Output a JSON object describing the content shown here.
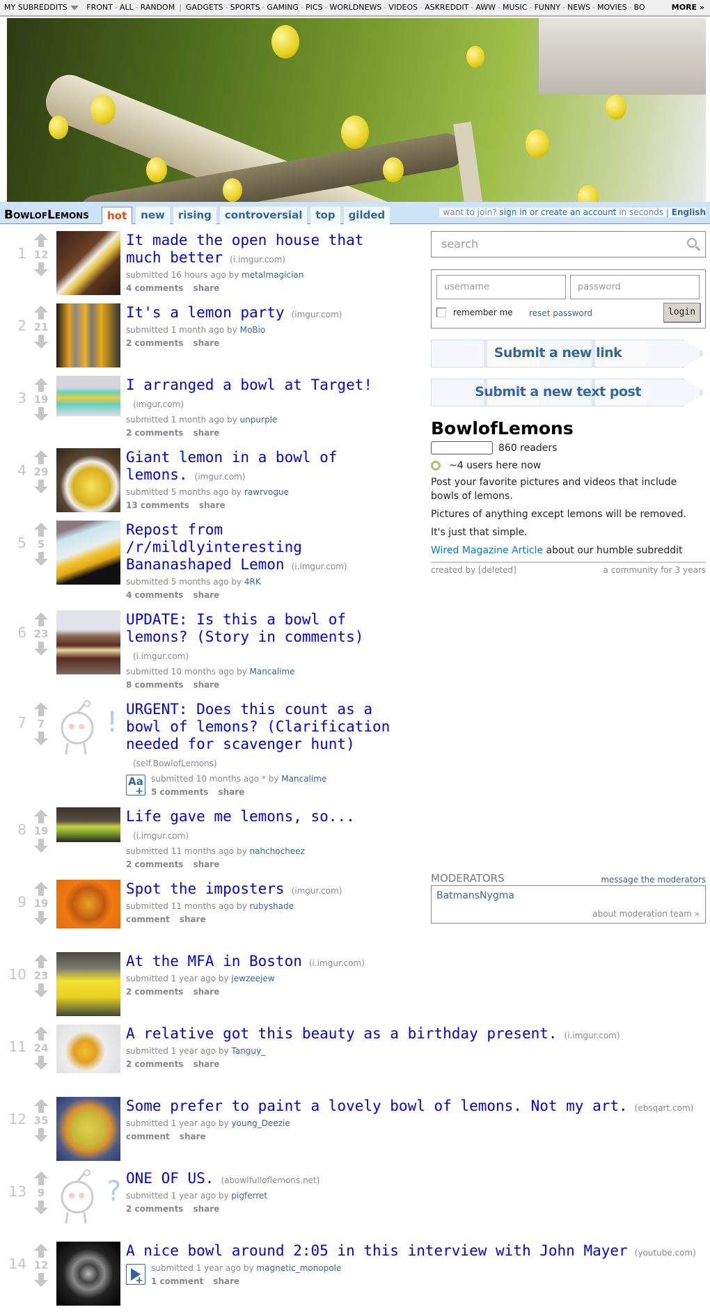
{
  "topbar": {
    "my_subreddits": "My Subreddits",
    "primary": [
      "Front",
      "All",
      "Random"
    ],
    "subs": [
      "Gadgets",
      "Sports",
      "Gaming",
      "Pics",
      "Worldnews",
      "Videos",
      "AskReddit",
      "Aww",
      "Music",
      "Funny",
      "News",
      "Movies",
      "Bo"
    ],
    "more": "more »"
  },
  "header": {
    "subreddit": "BowlofLemons",
    "tabs": [
      {
        "label": "hot",
        "selected": true
      },
      {
        "label": "new"
      },
      {
        "label": "rising"
      },
      {
        "label": "controversial"
      },
      {
        "label": "top"
      },
      {
        "label": "gilded"
      }
    ],
    "login_prefix": "want to join? ",
    "login_link": "sign in or create an account",
    "login_suffix": " in seconds | ",
    "language": "English"
  },
  "sidebar": {
    "search_placeholder": "search",
    "username_placeholder": "username",
    "password_placeholder": "password",
    "remember_me": "remember me",
    "reset_password": "reset password",
    "login": "login",
    "submit_link": "Submit a new link",
    "submit_text": "Submit a new text post",
    "title": "BowlofLemons",
    "readers": "860 readers",
    "online": "~4 users here now",
    "desc1": "Post your favorite pictures and videos that include bowls of lemons.",
    "desc2": "Pictures of anything except lemons will be removed.",
    "desc3": "It's just that simple.",
    "wired_link": "Wired Magazine Article",
    "wired_suffix": " about our humble subreddit",
    "created_by": "created by [deleted]",
    "age": "a community for 3 years",
    "moderators_title": "MODERATORS",
    "message_mods": "message the moderators",
    "moderators": [
      "BatmansNygma"
    ],
    "about_mods": "about moderation team »"
  },
  "posts": [
    {
      "rank": "1",
      "score": "12",
      "title": "It made the open house that much better",
      "domain": "(i.imgur.com)",
      "time": "submitted 16 hours ago by ",
      "author": "metalmagician",
      "comments": "4 comments",
      "share": "share",
      "thumb": "photo"
    },
    {
      "rank": "2",
      "score": "21",
      "title": "It's a lemon party",
      "domain": "(imgur.com)",
      "time": "submitted 1 month ago by ",
      "author": "MoBio",
      "comments": "2 comments",
      "share": "share",
      "thumb": "photo"
    },
    {
      "rank": "3",
      "score": "19",
      "title": "I arranged a bowl at Target!",
      "domain": "(imgur.com)",
      "time": "submitted 1 month ago by ",
      "author": "unpurple",
      "comments": "2 comments",
      "share": "share",
      "thumb": "photo"
    },
    {
      "rank": "4",
      "score": "29",
      "title": "Giant lemon in a bowl of lemons.",
      "domain": "(imgur.com)",
      "time": "submitted 5 months ago by ",
      "author": "rawrvogue",
      "comments": "13 comments",
      "share": "share",
      "thumb": "photo"
    },
    {
      "rank": "5",
      "score": "5",
      "title": "Repost from /r/mildlyinteresting Bananashaped Lemon",
      "domain": "(i.imgur.com)",
      "time": "submitted 5 months ago by ",
      "author": "4RK",
      "comments": "4 comments",
      "share": "share",
      "thumb": "photo"
    },
    {
      "rank": "6",
      "score": "23",
      "title": "UPDATE: Is this a bowl of lemons? (Story in comments)",
      "domain": "(i.imgur.com)",
      "time": "submitted 10 months ago by ",
      "author": "Mancalime",
      "comments": "8 comments",
      "share": "share",
      "thumb": "photo"
    },
    {
      "rank": "7",
      "score": "7",
      "title": "URGENT: Does this count as a bowl of lemons? (Clarification needed for scavenger hunt)",
      "domain": "(self.BowlofLemons)",
      "time": "submitted 10 months ago * by ",
      "author": "Mancalime",
      "comments": "5 comments",
      "share": "share",
      "thumb": "self-alien",
      "expando": "Aa"
    },
    {
      "rank": "8",
      "score": "19",
      "title": "Life gave me lemons, so...",
      "domain": "(i.imgur.com)",
      "time": "submitted 11 months ago by ",
      "author": "nahchocheez",
      "comments": "2 comments",
      "share": "share",
      "thumb": "photo"
    },
    {
      "rank": "9",
      "score": "19",
      "title": "Spot the imposters",
      "domain": "(imgur.com)",
      "time": "submitted 11 months ago by ",
      "author": "rubyshade",
      "comments": "comment",
      "share": "share",
      "thumb": "photo"
    },
    {
      "rank": "10",
      "score": "23",
      "title": "At the MFA in Boston",
      "domain": "(i.imgur.com)",
      "time": "submitted 1 year ago by ",
      "author": "jewzeejew",
      "comments": "2 comments",
      "share": "share",
      "thumb": "photo"
    },
    {
      "rank": "11",
      "score": "24",
      "title": "A relative got this beauty as a birthday present.",
      "domain": "(i.imgur.com)",
      "time": "submitted 1 year ago by ",
      "author": "Tanguy_",
      "comments": "2 comments",
      "share": "share",
      "thumb": "photo"
    },
    {
      "rank": "12",
      "score": "35",
      "title": "Some prefer to paint a lovely bowl of lemons. Not my art.",
      "domain": "(ebsqart.com)",
      "time": "submitted 1 year ago by ",
      "author": "young_Deezie",
      "comments": "comment",
      "share": "share",
      "thumb": "photo"
    },
    {
      "rank": "13",
      "score": "9",
      "title": "ONE OF US.",
      "domain": "(abowlfulloflemons.net)",
      "time": "submitted 1 year ago by ",
      "author": "pigferret",
      "comments": "2 comments",
      "share": "share",
      "thumb": "alien-question"
    },
    {
      "rank": "14",
      "score": "12",
      "title": "A nice bowl around 2:05 in this interview with John Mayer",
      "domain": "(youtube.com)",
      "time": "submitted 1 year ago by ",
      "author": "magnetic_monopole",
      "comments": "1 comment",
      "share": "share",
      "thumb": "photo",
      "expando": "video"
    }
  ]
}
